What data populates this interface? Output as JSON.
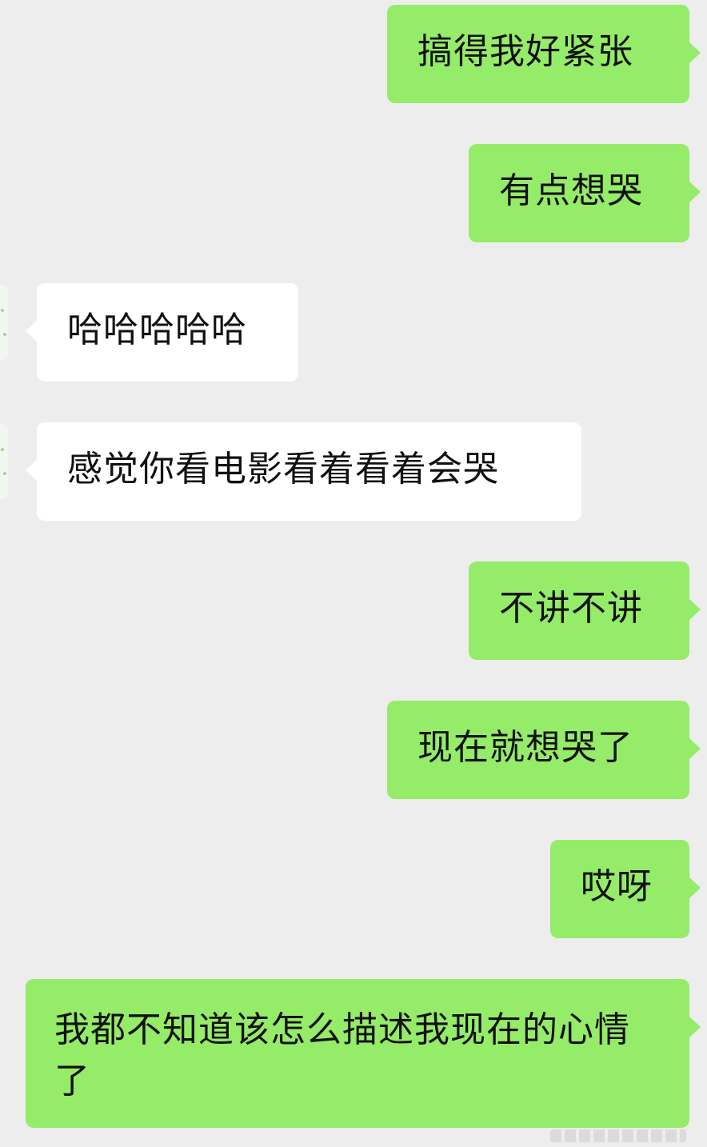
{
  "messages": [
    {
      "side": "out",
      "text": "搞得我好紧张"
    },
    {
      "side": "out",
      "text": "有点想哭"
    },
    {
      "side": "in",
      "text": "哈哈哈哈哈"
    },
    {
      "side": "in",
      "text": "感觉你看电影看着看着会哭"
    },
    {
      "side": "out",
      "text": "不讲不讲"
    },
    {
      "side": "out",
      "text": "现在就想哭了"
    },
    {
      "side": "out",
      "text": "哎呀"
    },
    {
      "side": "out",
      "text": "我都不知道该怎么描述我现在的心情了"
    }
  ],
  "colors": {
    "background": "#ededed",
    "outgoing_bubble": "#95ec69",
    "incoming_bubble": "#ffffff",
    "text": "#111111"
  }
}
